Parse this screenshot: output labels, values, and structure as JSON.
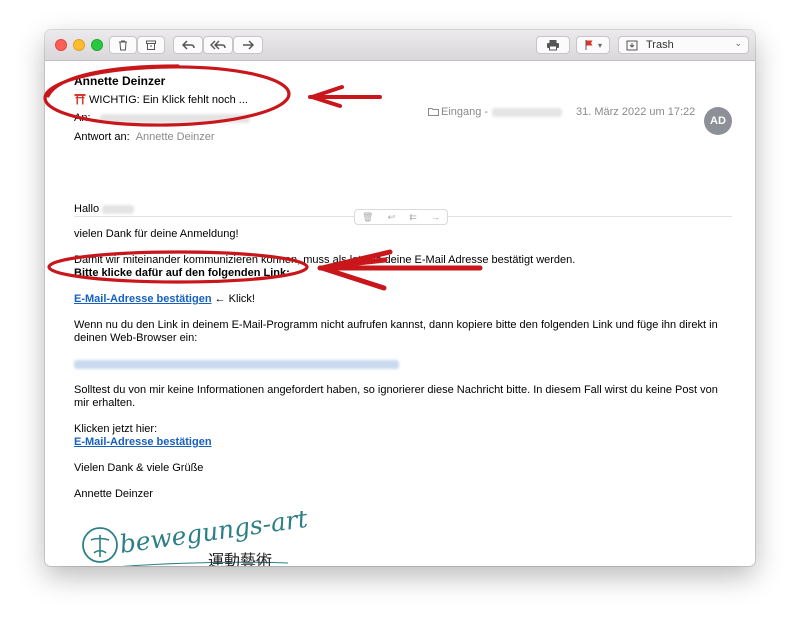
{
  "toolbar": {
    "folder": "Trash"
  },
  "header": {
    "sender": "Annette Deinzer",
    "subject_icon": "torii-gate-emoji",
    "subject": "WICHTIG: Ein Klick fehlt noch ...",
    "to_label": "An:",
    "reply_label": "Antwort an:",
    "reply_value": "Annette Deinzer",
    "mailbox": "Eingang -",
    "date": "31. März 2022 um 17:22",
    "avatar": "AD"
  },
  "body": {
    "greeting": "Hallo",
    "thanks": "vielen Dank für deine Anmeldung!",
    "confirm_line": "Damit wir miteinander kommunizieren können, muss als letztes deine E-Mail Adresse bestätigt werden.",
    "click_instruction": "Bitte klicke dafür auf den folgenden Link:",
    "confirm_link": "E-Mail-Adresse bestätigen",
    "klick_suffix": "← Klick!",
    "fallback_text": "Wenn nu du den Link in deinem E-Mail-Programm nicht aufrufen kannst, dann kopiere bitte den folgenden Link und füge ihn direkt in deinen Web-Browser ein:",
    "ignore_text": "Solltest du von mir keine Informationen angefordert haben, so ignorierer diese Nachricht bitte. In diesem Fall wirst du keine Post von mir erhalten.",
    "click_here": "Klicken jetzt hier:",
    "confirm_link_2": "E-Mail-Adresse bestätigen",
    "closing": "Vielen Dank & viele Grüße",
    "signature": "Annette Deinzer"
  },
  "logo": {
    "latin": "bewegungs-art",
    "chinese": "運動藝術"
  },
  "colors": {
    "annotation_red": "#c8161b",
    "link_blue": "#1560c0",
    "logo_teal": "#2d7f86"
  }
}
